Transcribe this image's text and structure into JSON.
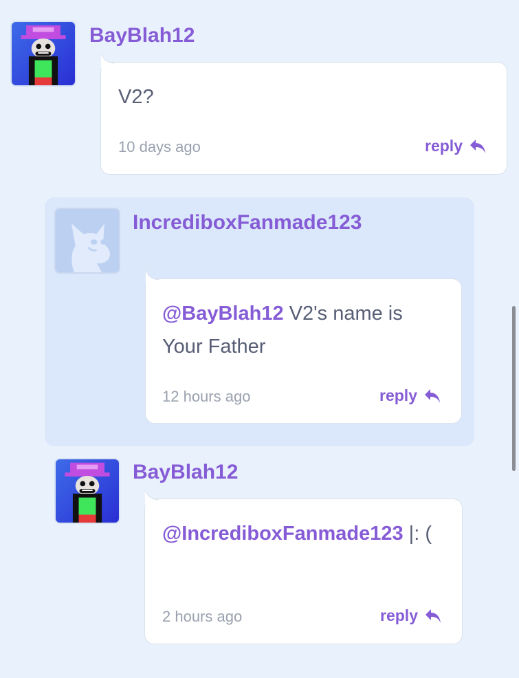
{
  "comments": [
    {
      "username": "BayBlah12",
      "avatar": "incredibox-character-avatar",
      "text": "V2?",
      "time": "10 days ago",
      "reply_label": "reply"
    },
    {
      "username": "IncrediboxFanmade123",
      "avatar": "default-scratch-cat-avatar",
      "mention": "@BayBlah12",
      "text": " V2's name is Your Father",
      "time": "12 hours ago",
      "reply_label": "reply"
    },
    {
      "username": "BayBlah12",
      "avatar": "incredibox-character-avatar",
      "mention": "@IncrediboxFanmade123",
      "text": " |: (",
      "time": "2 hours ago",
      "reply_label": "reply"
    }
  ],
  "colors": {
    "page_background": "#e9f1fc",
    "reply_background": "#dbe8fb",
    "accent": "#855cd6",
    "text": "#575e75",
    "muted": "#9aa1ae"
  },
  "icons": {
    "reply": "reply-arrow-icon"
  }
}
